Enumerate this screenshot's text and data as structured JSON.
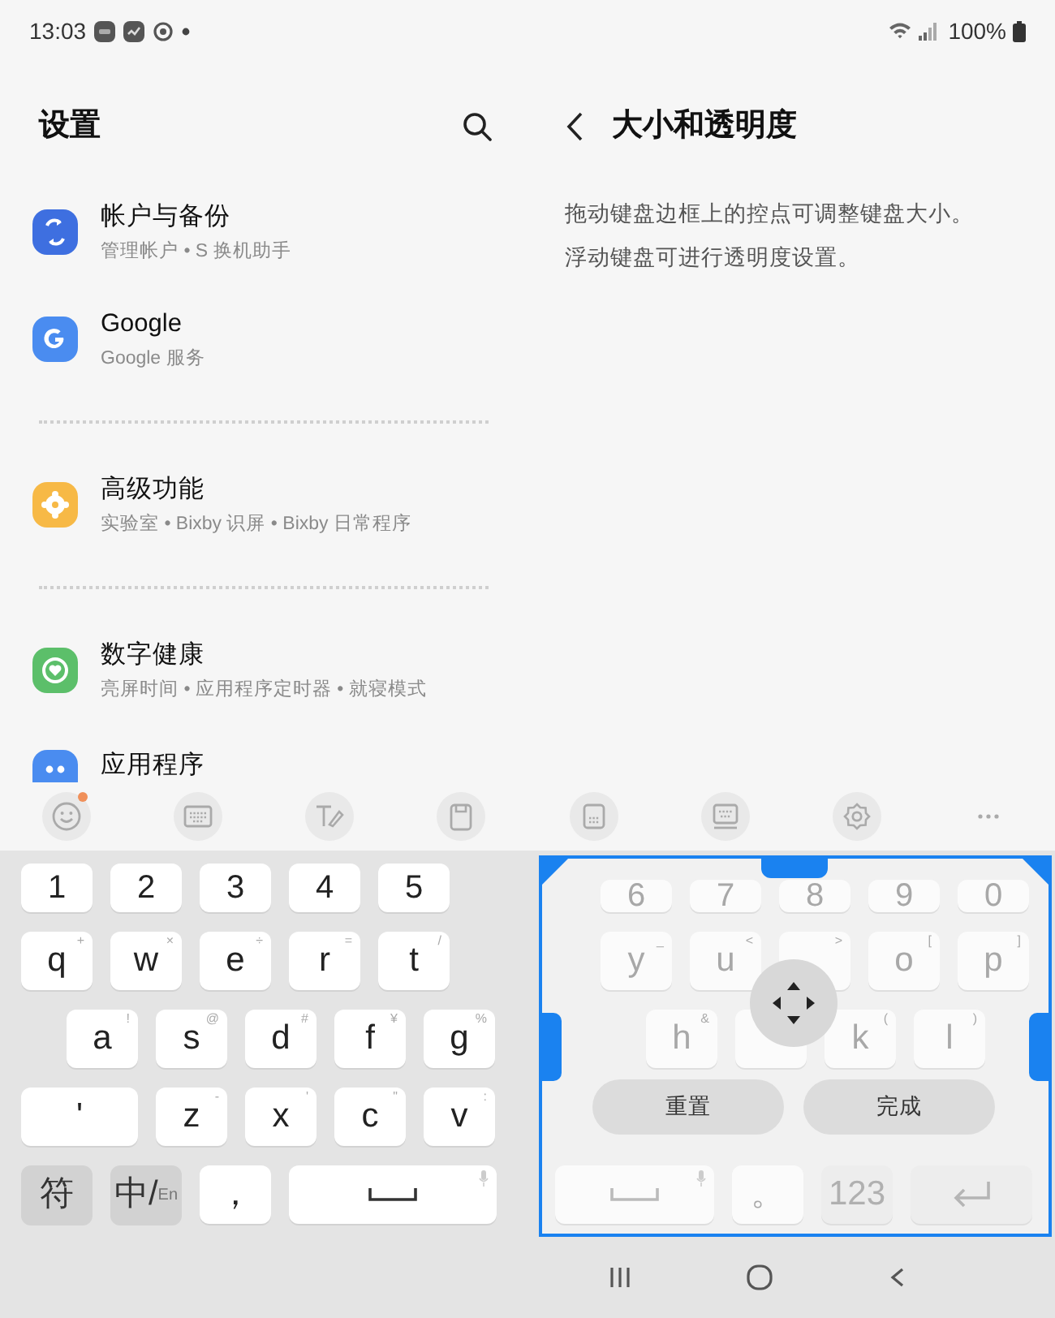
{
  "status_bar": {
    "time": "13:03",
    "battery": "100%"
  },
  "settings": {
    "title": "设置",
    "entries": [
      {
        "kind": "item",
        "color": "#3e6fe0",
        "title": "帐户与备份",
        "subtitle": "管理帐户 • S 换机助手"
      },
      {
        "kind": "item",
        "color": "#4a8cf0",
        "title": "Google",
        "subtitle": "Google 服务"
      },
      {
        "kind": "divider"
      },
      {
        "kind": "item",
        "color": "#f7b946",
        "title": "高级功能",
        "subtitle": "实验室 • Bixby 识屏 • Bixby 日常程序"
      },
      {
        "kind": "divider"
      },
      {
        "kind": "item",
        "color": "#5cbf6a",
        "title": "数字健康",
        "subtitle": "亮屏时间 • 应用程序定时器 • 就寝模式"
      },
      {
        "kind": "item",
        "color": "#4a8cf0",
        "title": "应用程序"
      }
    ]
  },
  "detail": {
    "title": "大小和透明度",
    "lines": [
      "拖动键盘边框上的控点可调整键盘大小。",
      "浮动键盘可进行透明度设置。"
    ]
  },
  "toolbars": [
    [
      {
        "badge": true
      },
      {
        "badge": false
      },
      {
        "badge": false
      },
      {
        "badge": false
      }
    ],
    [
      {
        "badge": false
      },
      {
        "badge": false
      },
      {
        "badge": false
      },
      {
        "badge": false
      }
    ]
  ],
  "keyboard": {
    "rows": [
      [
        {
          "kind": "char",
          "label": "1"
        },
        {
          "kind": "char",
          "label": "2"
        },
        {
          "kind": "char",
          "label": "3"
        },
        {
          "kind": "char",
          "label": "4"
        },
        {
          "kind": "char",
          "label": "5"
        }
      ],
      [
        {
          "kind": "char",
          "label": "q",
          "hint": "+"
        },
        {
          "kind": "char",
          "label": "w",
          "hint": "×"
        },
        {
          "kind": "char",
          "label": "e",
          "hint": "÷"
        },
        {
          "kind": "char",
          "label": "r",
          "hint": "="
        },
        {
          "kind": "char",
          "label": "t",
          "hint": "/"
        }
      ],
      [
        {
          "kind": "char",
          "label": "a",
          "hint": "!"
        },
        {
          "kind": "char",
          "label": "s",
          "hint": "@"
        },
        {
          "kind": "char",
          "label": "d",
          "hint": "#"
        },
        {
          "kind": "char",
          "label": "f",
          "hint": "¥"
        },
        {
          "kind": "char",
          "label": "g",
          "hint": "%"
        }
      ],
      [
        {
          "kind": "wide",
          "label": "'"
        },
        {
          "kind": "char",
          "label": "z",
          "hint": "-"
        },
        {
          "kind": "char",
          "label": "x",
          "hint": "'"
        },
        {
          "kind": "char",
          "label": "c",
          "hint": "\""
        },
        {
          "kind": "char",
          "label": "v",
          "hint": ":"
        }
      ],
      [
        {
          "kind": "fn",
          "label": "符"
        },
        {
          "kind": "fn",
          "label": "中/",
          "sublabel": "En"
        },
        {
          "kind": "char",
          "label": "，"
        },
        {
          "kind": "space"
        }
      ]
    ]
  },
  "floating_keyboard": {
    "rows": [
      [
        {
          "kind": "char",
          "label": "6"
        },
        {
          "kind": "char",
          "label": "7"
        },
        {
          "kind": "char",
          "label": "8"
        },
        {
          "kind": "char",
          "label": "9"
        },
        {
          "kind": "char",
          "label": "0"
        }
      ],
      [
        {
          "kind": "char",
          "label": "y",
          "hint": "_"
        },
        {
          "kind": "char",
          "label": "u",
          "hint": "<"
        },
        {
          "kind": "char",
          "hint": ">"
        },
        {
          "kind": "char",
          "label": "o",
          "hint": "["
        },
        {
          "kind": "char",
          "label": "p",
          "hint": "]"
        }
      ],
      [
        {
          "kind": "char",
          "label": "h",
          "hint": "&"
        },
        {
          "kind": "char"
        },
        {
          "kind": "char",
          "label": "k",
          "hint": "("
        },
        {
          "kind": "char",
          "label": "l",
          "hint": ")"
        }
      ],
      [],
      [
        {
          "kind": "space"
        },
        {
          "kind": "char",
          "label": "。"
        },
        {
          "kind": "fn",
          "label": "123"
        },
        {
          "kind": "enter"
        }
      ]
    ],
    "buttons": [
      {
        "label": "重置"
      },
      {
        "label": "完成"
      }
    ]
  }
}
